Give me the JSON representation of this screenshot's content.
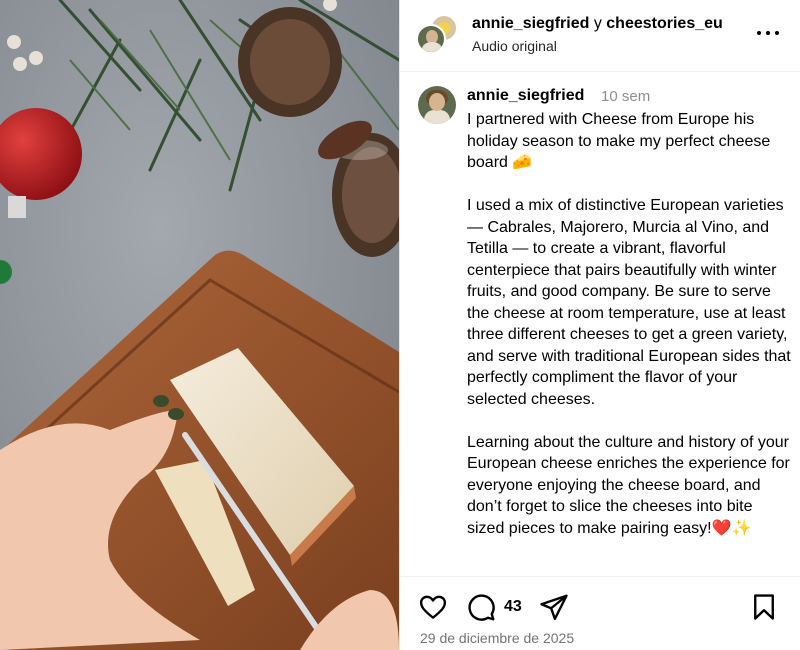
{
  "header": {
    "user1": "annie_siegfried",
    "conjunction": "y",
    "user2": "cheestories_eu",
    "audio": "Audio original"
  },
  "caption": {
    "username": "annie_siegfried",
    "time": "10 sem",
    "paragraphs": [
      "I partnered with Cheese from Europe his holiday season to make my perfect cheese board 🧀",
      "I used a mix of distinctive European varieties — Cabrales, Majorero, Murcia al Vino, and Tetilla — to create a vibrant, flavorful centerpiece that pairs beautifully with winter fruits, and good company. Be sure to serve the cheese at room temperature, use at least three different cheeses to get a green variety, and serve with traditional European sides that perfectly compliment the flavor of your selected cheeses.",
      "Learning about the culture and history of your European cheese enriches the experience for everyone enjoying the cheese board, and don’t forget to slice the cheeses into bite sized pieces to make pairing easy!❤️✨"
    ]
  },
  "actions": {
    "comment_count": "43",
    "date": "29 de diciembre de 2025"
  },
  "icons": {
    "like": "heart-icon",
    "comment": "comment-icon",
    "share": "share-icon",
    "save": "bookmark-icon",
    "more": "more-icon"
  }
}
